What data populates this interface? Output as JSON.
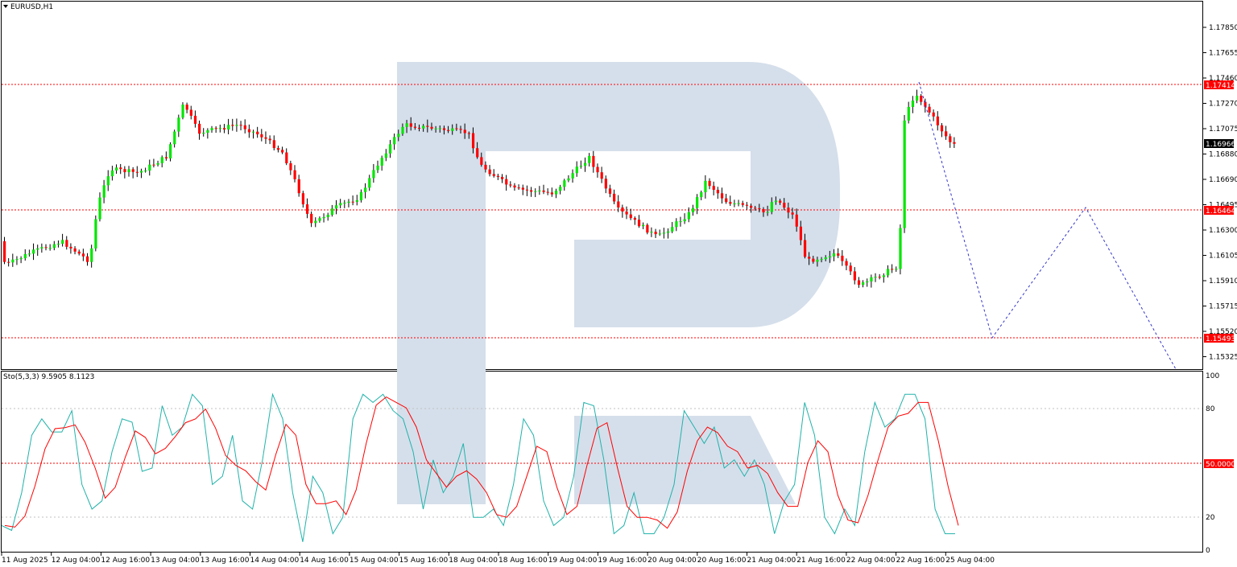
{
  "window": {
    "title": "EURUSD,H1"
  },
  "price_axis": {
    "labels": [
      "1.17850",
      "1.17655",
      "1.17460",
      "1.17270",
      "1.17075",
      "1.16880",
      "1.16690",
      "1.16495",
      "1.16300",
      "1.16105",
      "1.15910",
      "1.15715",
      "1.15520",
      "1.15325"
    ],
    "levels": [
      {
        "price": "1.17414",
        "value": 1.17414,
        "color": "#ff0000"
      },
      {
        "price": "1.16464",
        "value": 1.16464,
        "color": "#ff0000"
      },
      {
        "price": "1.15493",
        "value": 1.15493,
        "color": "#ff0000"
      }
    ],
    "current_price": {
      "price": "1.16966",
      "value": 1.16966,
      "color": "#000000"
    }
  },
  "indicator": {
    "title": "Sto(5,3,3) 9.5905 8.1123",
    "axis_labels": [
      "100",
      "80",
      "20",
      "0"
    ],
    "level_label": "50.0000",
    "level_color": "#ff0000",
    "main_color": "#20b2aa",
    "signal_color": "#ff0000"
  },
  "time_axis": {
    "labels": [
      "11 Aug 2025",
      "12 Aug 04:00",
      "12 Aug 16:00",
      "13 Aug 04:00",
      "13 Aug 16:00",
      "14 Aug 04:00",
      "14 Aug 16:00",
      "15 Aug 04:00",
      "15 Aug 16:00",
      "18 Aug 04:00",
      "18 Aug 16:00",
      "19 Aug 04:00",
      "19 Aug 16:00",
      "20 Aug 04:00",
      "20 Aug 16:00",
      "21 Aug 04:00",
      "21 Aug 16:00",
      "22 Aug 04:00",
      "22 Aug 16:00",
      "25 Aug 04:00"
    ]
  },
  "colors": {
    "bull": "#00e600",
    "bear": "#ff0000",
    "forecast": "#3535c8",
    "watermark": "#d5dfeb"
  },
  "chart_data": {
    "type": "candlestick",
    "symbol": "EURUSD",
    "timeframe": "H1",
    "ylim": [
      1.1523,
      1.1795
    ],
    "key_candles": [
      {
        "time": "11 Aug 2025",
        "close": 1.16
      },
      {
        "time": "13 Aug 04:00",
        "high": 1.1733
      },
      {
        "time": "14 Aug 16:00",
        "low": 1.1631
      },
      {
        "time": "15 Aug 16:00",
        "high": 1.1712
      },
      {
        "time": "20 Aug 04:00",
        "low": 1.1625
      },
      {
        "time": "22 Aug 04:00",
        "low": 1.1585
      },
      {
        "time": "22 Aug 16:00",
        "high": 1.1742
      },
      {
        "time": "25 Aug 04:00",
        "close": 1.16966
      }
    ],
    "forecast_path": [
      1.1742,
      1.1549,
      1.1646,
      1.153
    ],
    "stochastic": {
      "k_last": 9.5905,
      "d_last": 8.1123,
      "levels": [
        80,
        50,
        20
      ],
      "ylim": [
        0,
        100
      ]
    }
  }
}
